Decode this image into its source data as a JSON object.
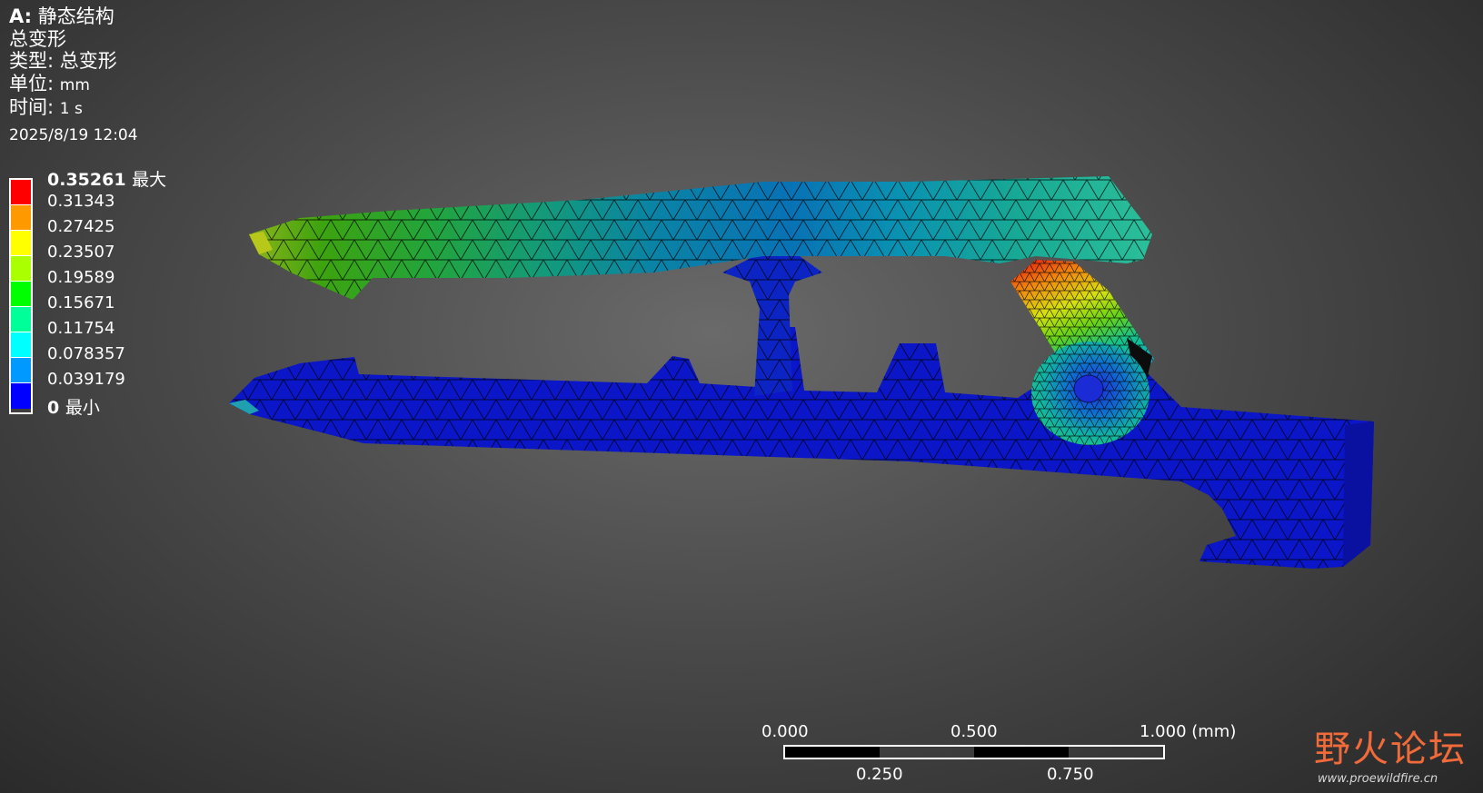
{
  "header": {
    "system_prefix": "A:",
    "system_name": "静态结构",
    "result_name": "总变形",
    "type_label": "类型:",
    "type_value": "总变形",
    "unit_label": "单位:",
    "unit_value": "mm",
    "time_label": "时间:",
    "time_value": "1 s",
    "date": "2025/8/19 12:04"
  },
  "legend": {
    "max_value": "0.35261",
    "max_label": "最大",
    "min_value": "0",
    "min_label": "最小",
    "values": [
      "0.31343",
      "0.27425",
      "0.23507",
      "0.19589",
      "0.15671",
      "0.11754",
      "0.078357",
      "0.039179"
    ],
    "colors": [
      "#ff0000",
      "#ff9900",
      "#ffff00",
      "#aaff00",
      "#00ff00",
      "#00ff99",
      "#00ffff",
      "#0099ff",
      "#0000ff"
    ]
  },
  "scale_bar": {
    "top_labels": [
      "0.000",
      "0.500",
      "1.000 (mm)"
    ],
    "bottom_labels": [
      "0.250",
      "0.750"
    ]
  },
  "watermark": {
    "text": "野火论坛",
    "url": "www.proewildfire.cn"
  }
}
